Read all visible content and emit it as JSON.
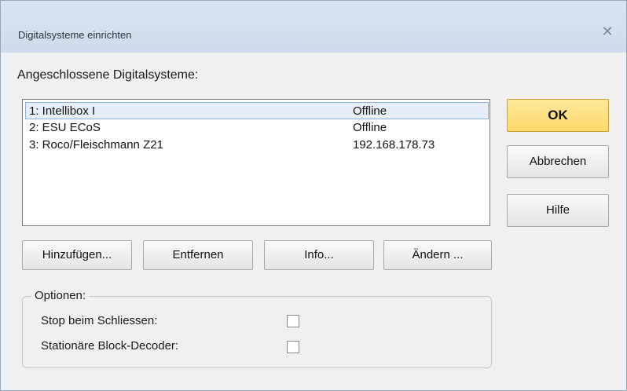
{
  "window": {
    "title": "Digitalsysteme einrichten",
    "close_glyph": "✕"
  },
  "list": {
    "label": "Angeschlossene Digitalsysteme:",
    "rows": [
      {
        "name": "1: Intellibox I",
        "status": "Offline",
        "selected": true
      },
      {
        "name": "2: ESU ECoS",
        "status": "Offline",
        "selected": false
      },
      {
        "name": "3: Roco/Fleischmann Z21",
        "status": "192.168.178.73",
        "selected": false
      }
    ]
  },
  "buttons": {
    "ok": "OK",
    "cancel": "Abbrechen",
    "help": "Hilfe",
    "add": "Hinzufügen...",
    "remove": "Entfernen",
    "info": "Info...",
    "edit": "Ändern ..."
  },
  "options": {
    "legend": "Optionen:",
    "stop_on_close": {
      "label": "Stop beim Schliessen:",
      "checked": false
    },
    "stationary_decoder": {
      "label": "Stationäre Block-Decoder:",
      "checked": false
    }
  },
  "colors": {
    "ok_button": "#fed86a",
    "selection": "#e6eef9"
  },
  "icons": {
    "close": "close-icon"
  }
}
